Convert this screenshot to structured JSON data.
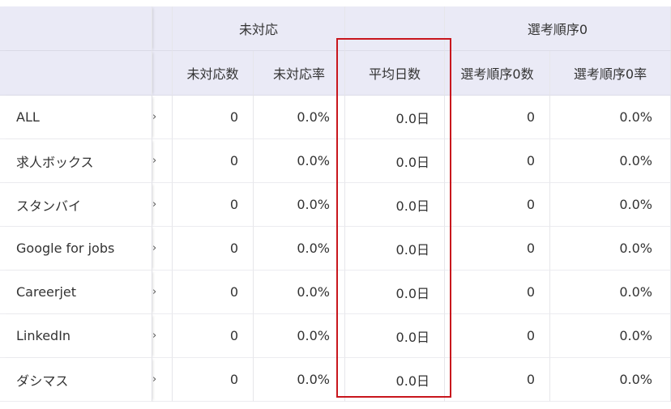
{
  "header": {
    "group_unhandled": "未対応",
    "group_selection": "選考順序0",
    "col_unhandled_count": "未対応数",
    "col_unhandled_rate": "未対応率",
    "col_avg_days": "平均日数",
    "col_selection_count": "選考順序0数",
    "col_selection_rate": "選考順序0率"
  },
  "rows": [
    {
      "name": "ALL",
      "marker": "›",
      "unhandled_count": "0",
      "unhandled_rate": "0.0%",
      "avg_days": "0.0日",
      "selection_count": "0",
      "selection_rate": "0.0%"
    },
    {
      "name": "求人ボックス",
      "marker": "›",
      "unhandled_count": "0",
      "unhandled_rate": "0.0%",
      "avg_days": "0.0日",
      "selection_count": "0",
      "selection_rate": "0.0%"
    },
    {
      "name": "スタンバイ",
      "marker": "›",
      "unhandled_count": "0",
      "unhandled_rate": "0.0%",
      "avg_days": "0.0日",
      "selection_count": "0",
      "selection_rate": "0.0%"
    },
    {
      "name": "Google for jobs",
      "marker": "›",
      "unhandled_count": "0",
      "unhandled_rate": "0.0%",
      "avg_days": "0.0日",
      "selection_count": "0",
      "selection_rate": "0.0%"
    },
    {
      "name": "Careerjet",
      "marker": "›",
      "unhandled_count": "0",
      "unhandled_rate": "0.0%",
      "avg_days": "0.0日",
      "selection_count": "0",
      "selection_rate": "0.0%"
    },
    {
      "name": "LinkedIn",
      "marker": "›",
      "unhandled_count": "0",
      "unhandled_rate": "0.0%",
      "avg_days": "0.0日",
      "selection_count": "0",
      "selection_rate": "0.0%"
    },
    {
      "name": "ダシマス",
      "marker": "›",
      "unhandled_count": "0",
      "unhandled_rate": "0.0%",
      "avg_days": "0.0日",
      "selection_count": "0",
      "selection_rate": "0.0%"
    }
  ],
  "colors": {
    "header_bg": "#eaeaf6",
    "highlight_border": "#c8161d"
  }
}
